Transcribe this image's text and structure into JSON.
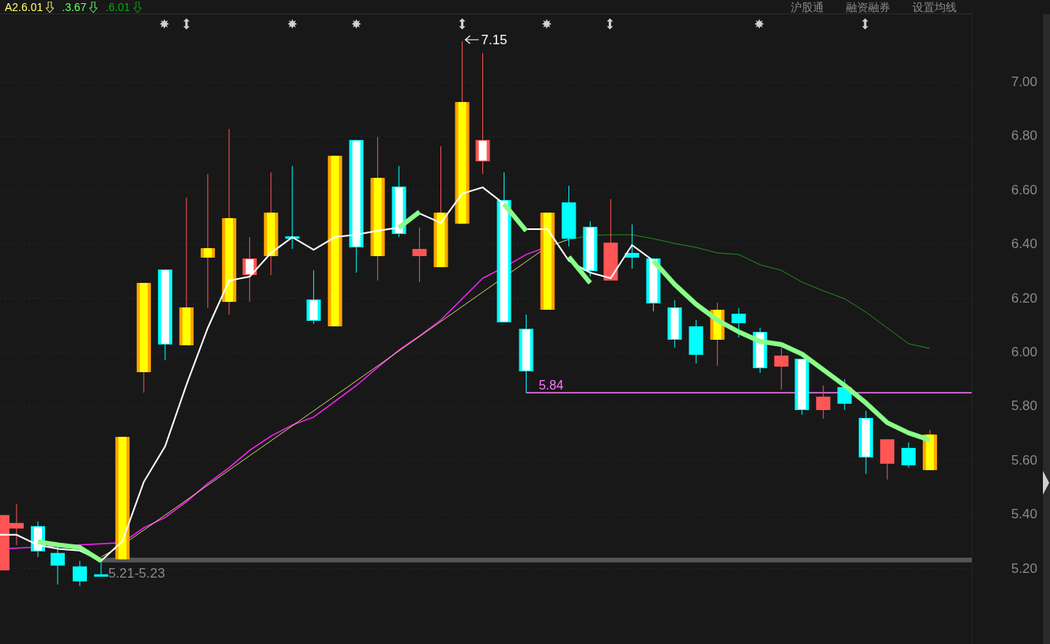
{
  "top_bar": {
    "indicators": [
      {
        "text": "A2.6.01",
        "color": "#ffff66"
      },
      {
        "text": ".3.67",
        "color": "#66ff66"
      },
      {
        "text": ".6.01",
        "color": "#00b000"
      }
    ],
    "links": [
      "沪股通",
      "融资融券",
      "设置均线"
    ]
  },
  "chart": {
    "price_axis": [
      "7.00",
      "6.80",
      "6.60",
      "6.40",
      "6.20",
      "6.00",
      "5.80",
      "5.60",
      "5.40",
      "5.20"
    ],
    "high_label": "7.15",
    "reference_label": "5.84",
    "low_label": "5.21-5.23"
  }
}
